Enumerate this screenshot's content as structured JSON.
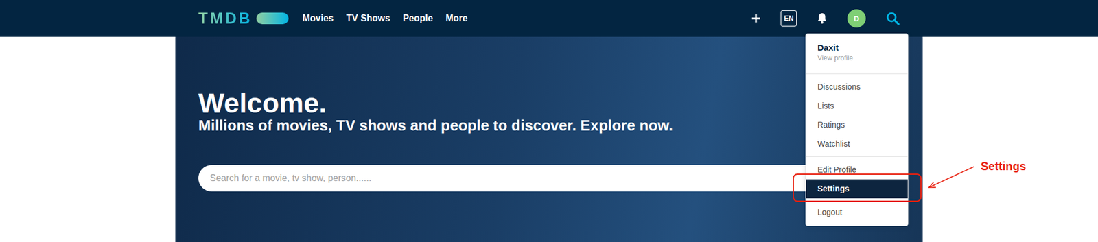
{
  "header": {
    "logo": "TMDB",
    "nav": [
      "Movies",
      "TV Shows",
      "People",
      "More"
    ],
    "language": "EN",
    "avatar": "D"
  },
  "hero": {
    "title": "Welcome.",
    "subtitle": "Millions of movies, TV shows and people to discover. Explore now.",
    "search": {
      "placeholder": "Search for a movie, tv show, person......"
    }
  },
  "user_menu": {
    "open": true,
    "name": "Daxit",
    "profile_link": "View profile",
    "groups": [
      [
        {
          "label": "Discussions",
          "selected": false
        },
        {
          "label": "Lists",
          "selected": false
        },
        {
          "label": "Ratings",
          "selected": false
        },
        {
          "label": "Watchlist",
          "selected": false
        }
      ],
      [
        {
          "label": "Edit Profile",
          "selected": false
        },
        {
          "label": "Settings",
          "selected": true
        }
      ],
      [
        {
          "label": "Logout",
          "selected": false
        }
      ]
    ]
  },
  "annotation": {
    "label": "Settings"
  }
}
